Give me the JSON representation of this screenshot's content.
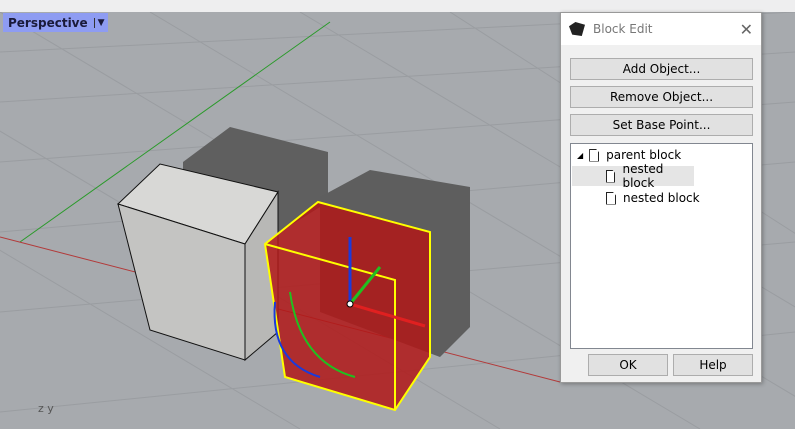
{
  "viewport": {
    "name": "Perspective",
    "axis_labels": "z y"
  },
  "dialog": {
    "title": "Block Edit",
    "buttons": {
      "add": "Add Object...",
      "remove": "Remove Object...",
      "base": "Set Base Point...",
      "ok": "OK",
      "help": "Help"
    },
    "tree": {
      "parent": "parent block",
      "children": [
        "nested block",
        "nested block"
      ]
    }
  },
  "colors": {
    "selection": "#ffff00",
    "viewport_tab": "#8e9cf2"
  }
}
